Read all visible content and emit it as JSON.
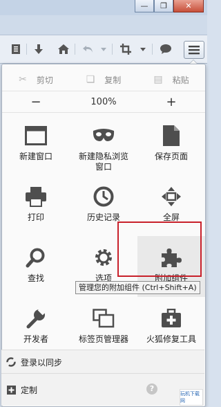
{
  "window": {
    "minimize_glyph": "—",
    "restore_glyph": "❐",
    "close_glyph": "✕"
  },
  "toolbar": {
    "icons": [
      "bookmarks-list-icon",
      "download-icon",
      "home-icon",
      "undo-icon",
      "dropdown-icon",
      "crop-icon",
      "dropdown-icon",
      "chat-icon",
      "menu-icon"
    ]
  },
  "edit": {
    "cut": "剪切",
    "copy": "复制",
    "paste": "粘贴"
  },
  "zoom": {
    "minus": "−",
    "level": "100%",
    "plus": "+"
  },
  "items": [
    {
      "name": "new-window",
      "label": "新建窗口"
    },
    {
      "name": "new-private-window",
      "label": "新建隐私浏览\n窗口"
    },
    {
      "name": "save-page",
      "label": "保存页面"
    },
    {
      "name": "print",
      "label": "打印"
    },
    {
      "name": "history",
      "label": "历史记录"
    },
    {
      "name": "fullscreen",
      "label": "全屏"
    },
    {
      "name": "find",
      "label": "查找"
    },
    {
      "name": "options",
      "label": "选项"
    },
    {
      "name": "addons",
      "label": "附加组件"
    },
    {
      "name": "developer",
      "label": "开发者"
    },
    {
      "name": "tab-groups",
      "label": "标签页管理器"
    },
    {
      "name": "firefox-repair",
      "label": "火狐修复工具"
    }
  ],
  "tooltip": "管理您的附加组件 (Ctrl+Shift+A)",
  "sync": {
    "label": "登录以同步"
  },
  "customize": {
    "label": "定制",
    "help": "?"
  },
  "watermark": "玩机下载网",
  "colors": {
    "highlight_border": "#c8202a",
    "panel_bg": "#fafafa"
  }
}
